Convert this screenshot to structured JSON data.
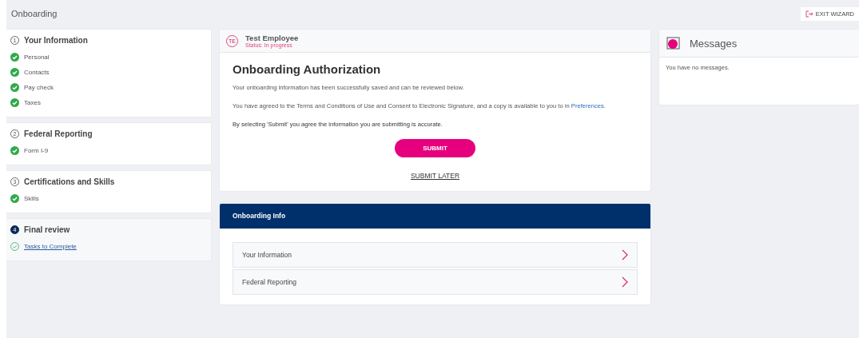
{
  "page_title": "Onboarding",
  "exit_button": "EXIT WIZARD",
  "steps": [
    {
      "number": "1",
      "title": "Your Information",
      "active": false,
      "tasks": [
        {
          "label": "Personal",
          "done": true,
          "link": false
        },
        {
          "label": "Contacts",
          "done": true,
          "link": false
        },
        {
          "label": "Pay check",
          "done": true,
          "link": false
        },
        {
          "label": "Taxes",
          "done": true,
          "link": false
        }
      ]
    },
    {
      "number": "2",
      "title": "Federal Reporting",
      "active": false,
      "tasks": [
        {
          "label": "Form I-9",
          "done": true,
          "link": false
        }
      ]
    },
    {
      "number": "3",
      "title": "Certifications and Skills",
      "active": false,
      "tasks": [
        {
          "label": "Skills",
          "done": true,
          "link": false
        }
      ]
    },
    {
      "number": "4",
      "title": "Final review",
      "active": true,
      "tasks": [
        {
          "label": "Tasks to Complete",
          "done": false,
          "link": true
        }
      ]
    }
  ],
  "employee": {
    "initials": "TE",
    "name": "Test Employee",
    "status": "Status: In progress"
  },
  "authorization": {
    "title": "Onboarding Authorization",
    "paragraphs": [
      {
        "text": "Your onboarding information has been successfully saved and can be reviewed below."
      },
      {
        "text": "You have agreed to the Terms and Conditions of Use and Consent to Electronic Signature, and a copy is available to you to in ",
        "link": "Preferences",
        "after": "."
      },
      {
        "text": "By selecting 'Submit' you agree the information you are submitting is accurate."
      }
    ],
    "submit": "SUBMIT",
    "submit_later": "SUBMIT LATER"
  },
  "onboarding_info": {
    "title": "Onboarding Info",
    "items": [
      "Your Information",
      "Federal Reporting"
    ]
  },
  "messages": {
    "title": "Messages",
    "empty": "You have no messages."
  }
}
